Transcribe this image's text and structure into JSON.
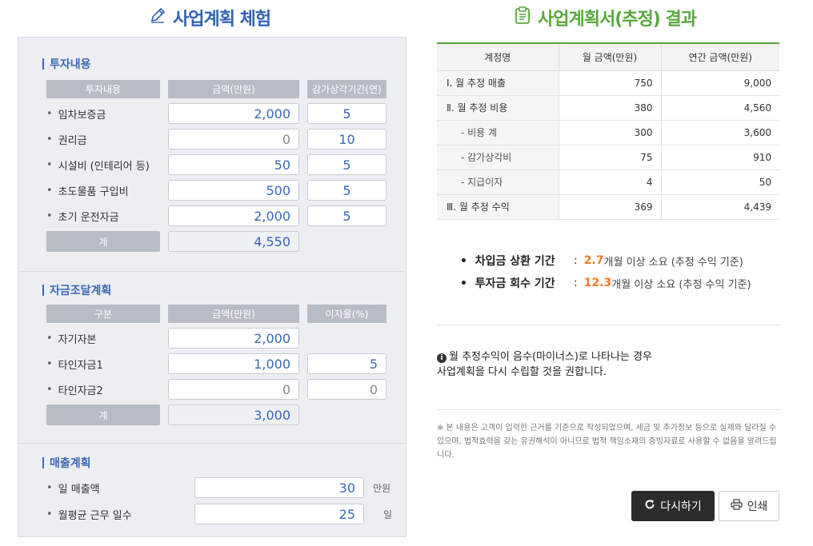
{
  "left_title": "사업계획 체험",
  "right_title": "사업계획서(추정) 결과",
  "investment": {
    "title": "투자내용",
    "headers": [
      "투자내용",
      "금액(만원)",
      "감가상각기간(연)"
    ],
    "rows": [
      {
        "label": "임차보증금",
        "amount": "2,000",
        "period": "5"
      },
      {
        "label": "권리금",
        "amount": "0",
        "period": "10"
      },
      {
        "label": "시설비 (인테리어 등)",
        "amount": "50",
        "period": "5"
      },
      {
        "label": "초도물품 구입비",
        "amount": "500",
        "period": "5"
      },
      {
        "label": "초기 운전자금",
        "amount": "2,000",
        "period": "5"
      }
    ],
    "total_label": "계",
    "total": "4,550"
  },
  "funding": {
    "title": "자금조달계획",
    "headers": [
      "구분",
      "금액(만원)",
      "이자율(%)"
    ],
    "rows": [
      {
        "label": "자기자본",
        "amount": "2,000",
        "rate": ""
      },
      {
        "label": "타인자금1",
        "amount": "1,000",
        "rate": "5"
      },
      {
        "label": "타인자금2",
        "amount": "0",
        "rate": "0"
      }
    ],
    "total_label": "계",
    "total": "3,000"
  },
  "sales": {
    "title": "매출계획",
    "rows": [
      {
        "label": "일 매출액",
        "value": "30",
        "unit": "만원"
      },
      {
        "label": "월평균 근무 일수",
        "value": "25",
        "unit": "일"
      }
    ]
  },
  "result": {
    "headers": [
      "계정명",
      "월 금액(만원)",
      "연간 금액(만원)"
    ],
    "rows": [
      {
        "name": "Ⅰ. 월 추정 매출",
        "monthly": "750",
        "annual": "9,000",
        "sub": false
      },
      {
        "name": "Ⅱ. 월 추정 비용",
        "monthly": "380",
        "annual": "4,560",
        "sub": false
      },
      {
        "name": "- 비용 계",
        "monthly": "300",
        "annual": "3,600",
        "sub": true
      },
      {
        "name": "- 감가상각비",
        "monthly": "75",
        "annual": "910",
        "sub": true
      },
      {
        "name": "- 지급이자",
        "monthly": "4",
        "annual": "50",
        "sub": true
      },
      {
        "name": "Ⅲ. 월 추정 수익",
        "monthly": "369",
        "annual": "4,439",
        "sub": false
      }
    ]
  },
  "summary": {
    "loan_label": "차입금 상환 기간",
    "loan_value": "2.7",
    "loan_tail": "개월 이상 소요 (추정 수익 기준)",
    "invest_label": "투자금 회수 기간",
    "invest_value": "12.3",
    "invest_tail": "개월 이상 소요 (추정 수익 기준)"
  },
  "notice": {
    "line1": "월 추정수익이 음수(마이너스)로 나타나는 경우",
    "line2": "사업계획을 다시 수립할 것을 권합니다."
  },
  "fine_print": "※ 본 내용은 고객이 입력한 근거를 기준으로 작성되었으며, 세금 및 추가정보 등으로 실제와 달라질 수 있으며, 법적효력을 갖는 유권해석이 아니므로 법적 책임소재의 증빙자료로 사용할 수 없음을 알려드립니다.",
  "buttons": {
    "retry": "다시하기",
    "print": "인쇄"
  },
  "colors": {
    "accent_blue": "#2f62b6",
    "accent_green": "#56a93a",
    "highlight_orange": "#ee7a2a"
  },
  "icons": {
    "left_title": "pencil-icon",
    "right_title": "clipboard-icon",
    "notice": "info-icon",
    "retry": "refresh-icon",
    "print": "printer-icon"
  }
}
